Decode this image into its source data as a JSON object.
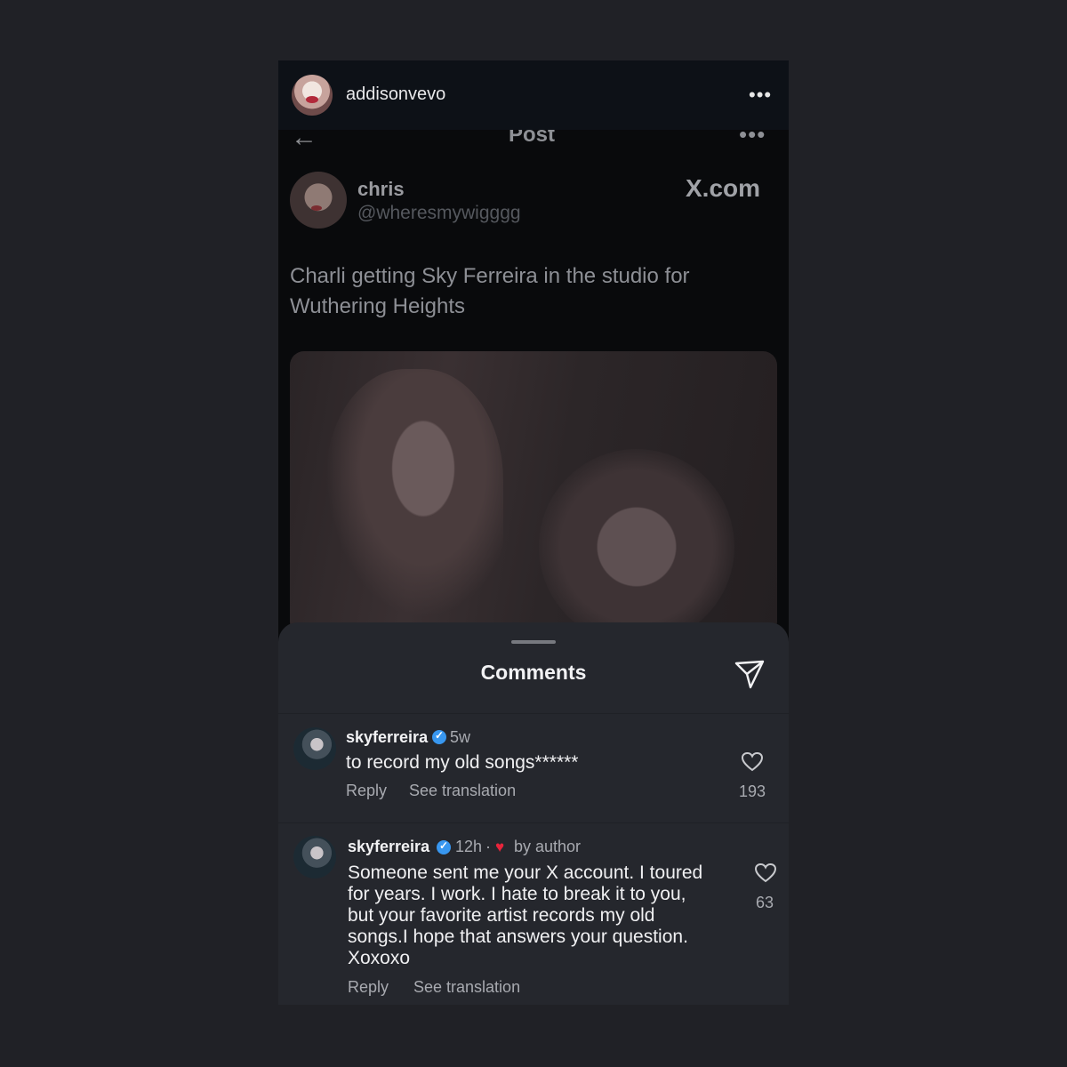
{
  "ig": {
    "username": "addisonvevo",
    "more": "•••"
  },
  "x_post": {
    "back": "←",
    "title": "Post",
    "more": "•••",
    "author_name": "chris",
    "author_handle": "@wheresmywigggg",
    "brand": "X.com",
    "text": "Charli getting Sky Ferreira in the studio for Wuthering Heights"
  },
  "comments_sheet": {
    "title": "Comments",
    "items": [
      {
        "user": "skyferreira",
        "time": "5w",
        "text": "to record my old songs******",
        "reply": "Reply",
        "translate": "See translation",
        "likes": "193"
      },
      {
        "user": "skyferreira",
        "time": "12h",
        "sep": "·",
        "badge": "by author",
        "text_lines": [
          "Someone sent me your X account. I toured",
          "for years. I work. I hate to break it to you,",
          "but your favorite artist records my old",
          "songs.I hope that answers your question.",
          "Xoxoxo"
        ],
        "reply": "Reply",
        "translate": "See translation",
        "likes": "63"
      }
    ]
  },
  "colors": {
    "verified": "#3897f0",
    "heart": "#e8243b"
  }
}
